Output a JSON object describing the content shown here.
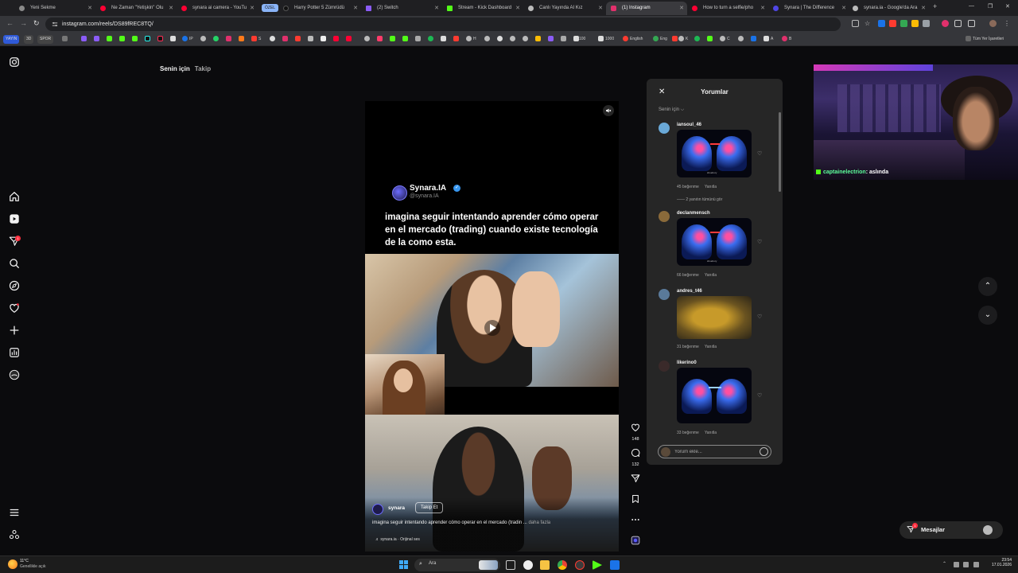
{
  "browser": {
    "tabs": [
      {
        "title": "Yeni Sekme",
        "color": "#8a8a8a"
      },
      {
        "title": "Ne Zaman \"Yetişkin\" Olu",
        "color": "#ff0033"
      },
      {
        "title": "synara ai camera - YouTu",
        "color": "#ff0033"
      },
      {
        "title": "Harry Potter 5 Zümrüdü",
        "color": "#111111"
      },
      {
        "title": "(2) Switch",
        "color": "#8b5cf6"
      },
      {
        "title": "Stream - Kick Dashboard",
        "color": "#53fc18"
      },
      {
        "title": "Canlı Yayında AI Kız",
        "color": "#bbbbbb"
      },
      {
        "title": "(1) Instagram",
        "color": "#e1306c"
      },
      {
        "title": "How to turn a selfie/pho",
        "color": "#ff0033"
      },
      {
        "title": "Synara | The Difference",
        "color": "#4f46e5"
      },
      {
        "title": "synara.ia - Google'da Ara",
        "color": "#bbbbbb"
      }
    ],
    "tab_badge": "ÖZEL",
    "url": "instagram.com/reels/DS89fREC8TQ/",
    "bookmarks": {
      "pills": [
        "YAYIN",
        "3D",
        "SPOR"
      ],
      "labels": [
        "IP",
        "S",
        "H",
        "100",
        "1000",
        "English",
        "Eng",
        "K",
        "C",
        "A",
        "B"
      ],
      "all_bookmarks": "Tüm Yer İşaretleri"
    }
  },
  "instagram": {
    "feed_tabs": {
      "for_you": "Senin için",
      "following": "Takip"
    },
    "reel": {
      "tweet_name": "Synara.IA",
      "tweet_check": "✓",
      "tweet_handle": "@synara.IA",
      "tweet_text": "imagina seguir intentando aprender cómo operar en el mercado (trading) cuando existe tecnología de la como esta.",
      "username": "synara",
      "follow_label": "Takip Et",
      "caption": "imagina seguir intentando aprender cómo operar en el mercado (tradin ...",
      "more_label": "daha fazla",
      "audio": "♬ synara.ia · Orijinal ses"
    },
    "actions": {
      "likes": "148",
      "comments": "132"
    },
    "comments_panel": {
      "title": "Yorumlar",
      "sort": "Senin için ⌵",
      "items": [
        {
          "user": "iansoul_46",
          "likes": "45 beğenme",
          "reply": "Yanıtla",
          "avatar_color": "#6aa9d8",
          "image": "brain",
          "image_tag": "shoebury"
        },
        {
          "user": "declanmensch",
          "likes": "66 beğenme",
          "reply": "Yanıtla",
          "avatar_color": "#8a6a3a",
          "image": "brain",
          "image_tag": "shoebury"
        },
        {
          "user": "andres_t46",
          "likes": "31 beğenme",
          "reply": "Yanıtla",
          "avatar_color": "#5a7a9a",
          "image": "shrek"
        },
        {
          "user": "likerino0",
          "likes": "33 beğenme",
          "reply": "Yanıtla",
          "avatar_color": "#3a2a2a",
          "image": "brain",
          "image_tag": ""
        }
      ],
      "view_replies": "—— 2 yanıtın tümünü gör",
      "input_placeholder": "Yorum ekle..."
    },
    "messages": {
      "label": "Mesajlar",
      "badge": "1"
    },
    "notification_badge": "1"
  },
  "webcam": {
    "chat_name": "captainelectrion",
    "chat_text": ": aslında"
  },
  "taskbar": {
    "weather_temp": "11°C",
    "weather_desc": "Genellikle açık",
    "search_label": "Ara",
    "time": "23:54",
    "date": "17.01.2026"
  }
}
